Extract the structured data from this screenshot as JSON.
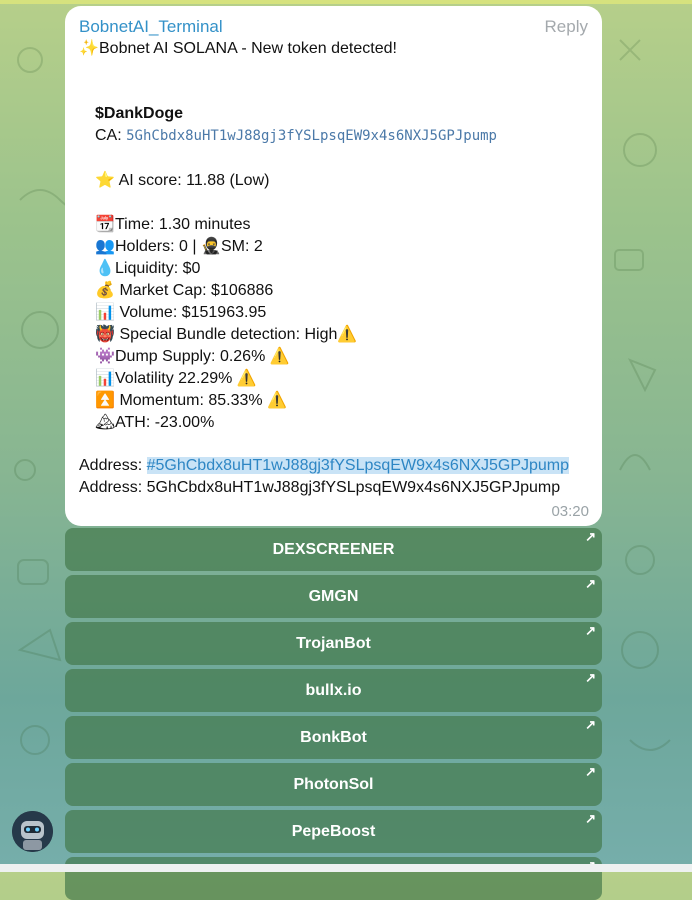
{
  "message": {
    "sender": "BobnetAI_Terminal",
    "reply_label": "Reply",
    "headline": "Bobnet AI SOLANA - New token detected!",
    "token_name": "$DankDoge",
    "ca_label": "CA:",
    "ca_value": "5GhCbdx8uHT1wJ88gj3fYSLpsqEW9x4s6NXJ5GPJpump",
    "ai_score": "AI score: 11.88 (Low)",
    "time": "Time: 1.30 minutes",
    "holders": "Holders: 0 |",
    "sm": "SM: 2",
    "liquidity": "Liquidity: $0",
    "market_cap": "Market Cap: $106886",
    "volume": "Volume: $151963.95",
    "bundle": "Special Bundle detection: High",
    "dump_supply": "Dump Supply: 0.26%",
    "volatility": "Volatility 22.29%",
    "momentum": "Momentum: 85.33%",
    "ath": "ATH: -23.00%",
    "address_label": "Address:",
    "address_hashtag": "#5GhCbdx8uHT1wJ88gj3fYSLpsqEW9x4s6NXJ5GPJpump",
    "address_plain": "5GhCbdx8uHT1wJ88gj3fYSLpsqEW9x4s6NXJ5GPJpump",
    "timestamp": "03:20"
  },
  "icons": {
    "sparkles": "✨",
    "star": "⭐",
    "calendar": "📆",
    "people": "👥",
    "ninja": "🥷",
    "droplet": "💧",
    "moneybag": "💰",
    "chart": "📊",
    "ogre": "👹",
    "alien_monster": "👾",
    "up_arrow": "⏫",
    "mountain": "🏔",
    "warning": "⚠️",
    "external_arrow": "↗"
  },
  "buttons": [
    "DEXSCREENER",
    "GMGN",
    "TrojanBot",
    "bullx.io",
    "BonkBot",
    "PhotonSol",
    "PepeBoost"
  ]
}
